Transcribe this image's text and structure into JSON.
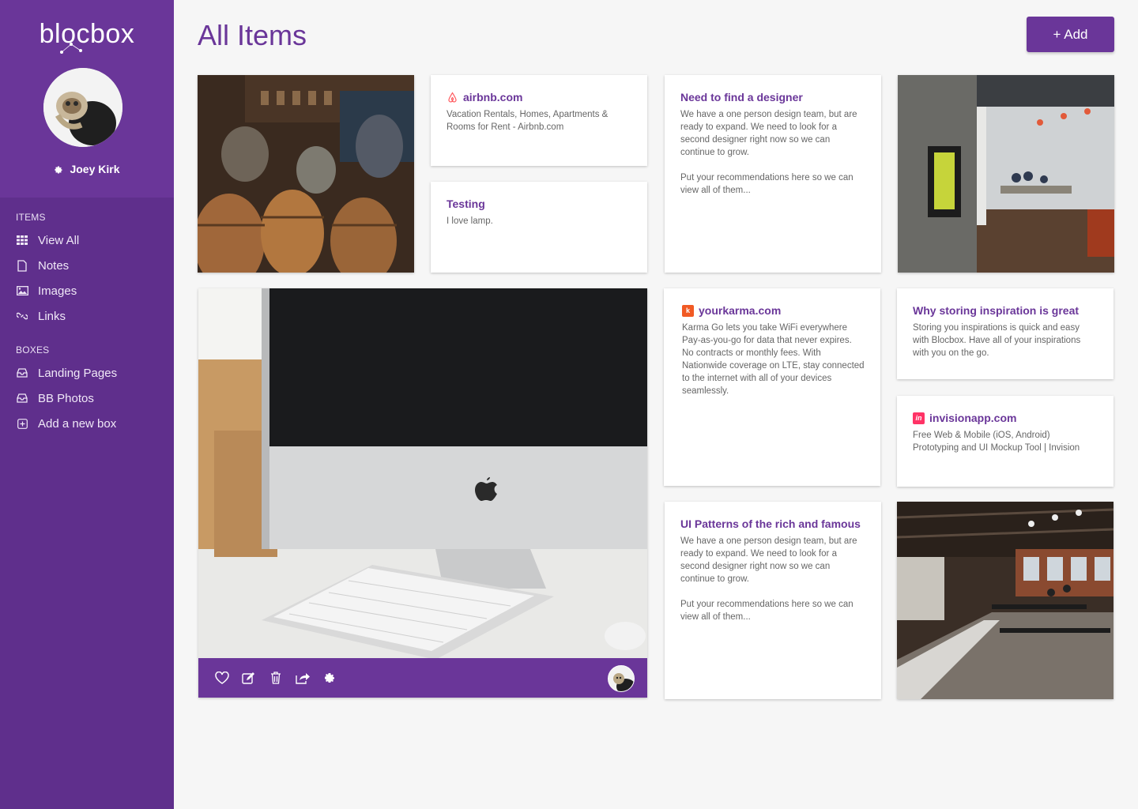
{
  "app": {
    "logo": "blocbox"
  },
  "user": {
    "name": "Joey Kirk"
  },
  "sidebar": {
    "items_label": "ITEMS",
    "items": [
      {
        "label": "View All",
        "icon": "grid-icon"
      },
      {
        "label": "Notes",
        "icon": "note-icon"
      },
      {
        "label": "Images",
        "icon": "image-icon"
      },
      {
        "label": "Links",
        "icon": "link-icon"
      }
    ],
    "boxes_label": "BOXES",
    "boxes": [
      {
        "label": "Landing Pages",
        "icon": "inbox-icon"
      },
      {
        "label": "BB Photos",
        "icon": "inbox-icon"
      },
      {
        "label": "Add a new box",
        "icon": "plus-square-icon"
      }
    ]
  },
  "main": {
    "title": "All Items",
    "add_label": "+ Add"
  },
  "cards": {
    "airbnb": {
      "title": "airbnb.com",
      "text": "Vacation Rentals, Homes, Apartments & Rooms for Rent - Airbnb.com"
    },
    "testing": {
      "title": "Testing",
      "text": "I love lamp."
    },
    "designer": {
      "title": "Need to find a designer",
      "text": "We have a one person design team, but are ready to expand. We need to look for a second designer right now so we can continue to grow.\n\nPut your recommendations here so we can view all of them..."
    },
    "yourkarma": {
      "title": "yourkarma.com",
      "text": "Karma Go lets you take WiFi everywhere Pay-as-you-go for data that never expires. No contracts or monthly fees. With Nationwide coverage on LTE, stay connected to the internet with all of your devices seamlessly."
    },
    "inspiration": {
      "title": "Why storing inspiration is great",
      "text": "Storing you inspirations is quick and easy with Blocbox. Have all of your inspirations with you on the go."
    },
    "invision": {
      "title": "invisionapp.com",
      "text": "Free Web & Mobile (iOS, Android) Prototyping and UI Mockup Tool | Invision"
    },
    "patterns": {
      "title": "UI Patterns of the rich and famous",
      "text": "We have a one person design team, but are ready to expand. We need to look for a second designer right now so we can continue to grow.\n\nPut your recommendations here so we can view all of them..."
    }
  },
  "colors": {
    "brand": "#6a3699",
    "sidebar": "#5f2f8c",
    "background": "#f6f6f6",
    "airbnb": "#ff5a5f",
    "karma": "#f15a24",
    "invision": "#ff3366"
  }
}
